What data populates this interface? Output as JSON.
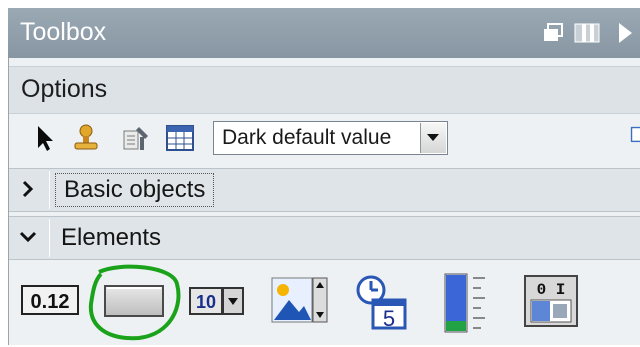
{
  "toolbox": {
    "title": "Toolbox",
    "controls": [
      "restore-icon",
      "pane-icon",
      "expand-arrow-icon"
    ]
  },
  "options": {
    "header": "Options",
    "tools": [
      "pointer-icon",
      "stamp-icon",
      "properties-icon",
      "table-icon"
    ],
    "dropdown_value": "Dark default value"
  },
  "sections": [
    {
      "label": "Basic objects",
      "state": "collapsed"
    },
    {
      "label": "Elements",
      "state": "expanded"
    }
  ],
  "elements": [
    {
      "icon": "io-field-icon",
      "text": "0.12"
    },
    {
      "icon": "button-icon",
      "text": "",
      "highlighted": true
    },
    {
      "icon": "symbolic-io-field-icon",
      "text": "10"
    },
    {
      "icon": "graphic-io-field-icon",
      "text": ""
    },
    {
      "icon": "date-time-field-icon",
      "text": "5"
    },
    {
      "icon": "bar-icon",
      "text": ""
    },
    {
      "icon": "switch-icon",
      "text": "0 I"
    }
  ],
  "colors": {
    "title_bg": "#8f9ea9",
    "section_bg": "#dfe4e8",
    "highlight_circle": "#1aa31a"
  }
}
